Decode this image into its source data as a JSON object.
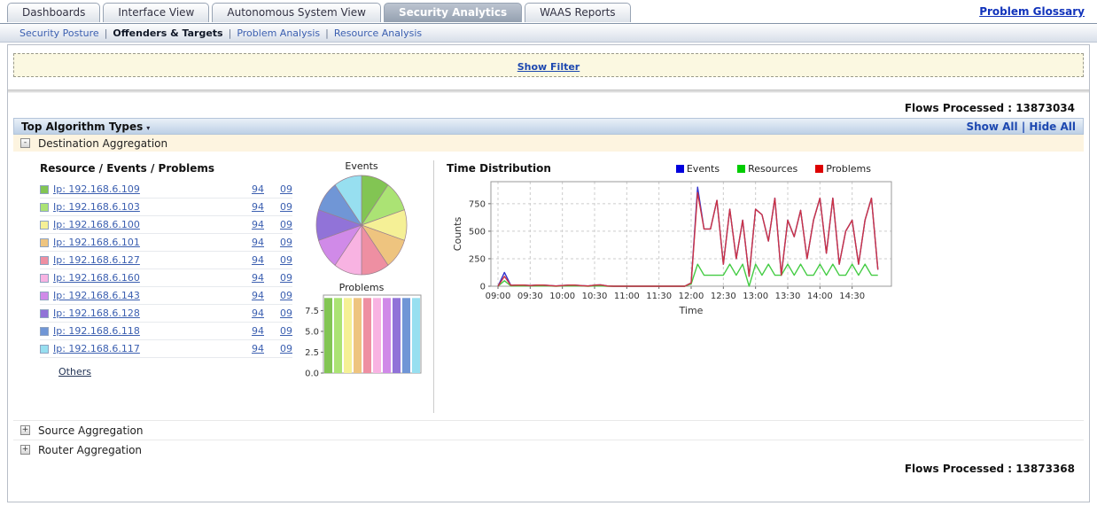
{
  "header": {
    "tabs": [
      {
        "label": "Dashboards"
      },
      {
        "label": "Interface View"
      },
      {
        "label": "Autonomous System View"
      },
      {
        "label": "Security Analytics"
      },
      {
        "label": "WAAS Reports"
      }
    ],
    "active_tab": "Security Analytics",
    "problem_glossary": "Problem Glossary",
    "subnav": [
      "Security Posture",
      "Offenders & Targets",
      "Problem Analysis",
      "Resource Analysis"
    ],
    "subnav_active": "Offenders & Targets",
    "separator": "|"
  },
  "filter": {
    "show_filter_label": "Show Filter"
  },
  "flows": {
    "top": "Flows Processed : 13873034",
    "bottom": "Flows Processed : 13873368"
  },
  "panel": {
    "title": "Top Algorithm Types",
    "show_all": "Show All",
    "hide_all": "Hide All",
    "links_separator": "|",
    "sections": [
      {
        "label": "Destination Aggregation",
        "state": "expanded"
      },
      {
        "label": "Source Aggregation",
        "state": "collapsed"
      },
      {
        "label": "Router Aggregation",
        "state": "collapsed"
      }
    ]
  },
  "icons": {
    "expanded": "-",
    "collapsed": "+",
    "panel_arrow": "▾"
  },
  "destination": {
    "list_title": "Resource / Events / Problems",
    "others_label": "Others",
    "resources": [
      {
        "label": "Ip: 192.168.6.109",
        "color": "#82c553",
        "events": "94",
        "problems": "09"
      },
      {
        "label": "Ip: 192.168.6.103",
        "color": "#abe374",
        "events": "94",
        "problems": "09"
      },
      {
        "label": "Ip: 192.168.6.100",
        "color": "#f5f096",
        "events": "94",
        "problems": "09"
      },
      {
        "label": "Ip: 192.168.6.101",
        "color": "#eec47f",
        "events": "94",
        "problems": "09"
      },
      {
        "label": "Ip: 192.168.6.127",
        "color": "#ee8fa2",
        "events": "94",
        "problems": "09"
      },
      {
        "label": "Ip: 192.168.6.160",
        "color": "#f8b3e2",
        "events": "94",
        "problems": "09"
      },
      {
        "label": "Ip: 192.168.6.143",
        "color": "#d08ae8",
        "events": "94",
        "problems": "09"
      },
      {
        "label": "Ip: 192.168.6.128",
        "color": "#9173d8",
        "events": "94",
        "problems": "09"
      },
      {
        "label": "Ip: 192.168.6.118",
        "color": "#7096d6",
        "events": "94",
        "problems": "09"
      },
      {
        "label": "Ip: 192.168.6.117",
        "color": "#97dff0",
        "events": "94",
        "problems": "09"
      }
    ]
  },
  "time_distribution": {
    "title": "Time Distribution",
    "legend": [
      {
        "label": "Events",
        "color": "#0000dd"
      },
      {
        "label": "Resources",
        "color": "#00cc00"
      },
      {
        "label": "Problems",
        "color": "#dd0000"
      }
    ]
  },
  "chart_data": [
    {
      "id": "events-pie",
      "type": "pie",
      "title": "Events",
      "labels": [
        "Ip: 192.168.6.109",
        "Ip: 192.168.6.103",
        "Ip: 192.168.6.100",
        "Ip: 192.168.6.101",
        "Ip: 192.168.6.127",
        "Ip: 192.168.6.160",
        "Ip: 192.168.6.143",
        "Ip: 192.168.6.128",
        "Ip: 192.168.6.118",
        "Ip: 192.168.6.117"
      ],
      "values": [
        10,
        10,
        10,
        10,
        10,
        10,
        10,
        10,
        10,
        10
      ],
      "colors": [
        "#82c553",
        "#abe374",
        "#f5f096",
        "#eec47f",
        "#ee8fa2",
        "#f8b3e2",
        "#d08ae8",
        "#9173d8",
        "#7096d6",
        "#97dff0"
      ]
    },
    {
      "id": "problems-bars",
      "type": "bar",
      "title": "Problems",
      "categories": [
        "Ip: 192.168.6.109",
        "Ip: 192.168.6.103",
        "Ip: 192.168.6.100",
        "Ip: 192.168.6.101",
        "Ip: 192.168.6.127",
        "Ip: 192.168.6.160",
        "Ip: 192.168.6.143",
        "Ip: 192.168.6.128",
        "Ip: 192.168.6.118",
        "Ip: 192.168.6.117"
      ],
      "values": [
        9,
        9,
        9,
        9,
        9,
        9,
        9,
        9,
        9,
        9
      ],
      "colors": [
        "#82c553",
        "#abe374",
        "#f5f096",
        "#eec47f",
        "#ee8fa2",
        "#f8b3e2",
        "#d08ae8",
        "#9173d8",
        "#7096d6",
        "#97dff0"
      ],
      "yticks": [
        0.0,
        2.5,
        5.0,
        7.5
      ],
      "ylim": [
        0,
        9.35
      ]
    },
    {
      "id": "time-distribution",
      "type": "line",
      "title": "Time Distribution",
      "xlabel": "Time",
      "ylabel": "Counts",
      "ylim": [
        0,
        950
      ],
      "yticks": [
        0,
        250,
        500,
        750
      ],
      "x_start_minutes": 540,
      "x_step_minutes": 6,
      "x_span_minutes": 360,
      "xtick_labels": [
        "09:00",
        "09:30",
        "10:00",
        "10:30",
        "11:00",
        "11:30",
        "12:00",
        "12:30",
        "13:00",
        "13:30",
        "14:00",
        "14:30"
      ],
      "grid": "dashed",
      "legend_position": "top-right",
      "series": [
        {
          "name": "Events",
          "color": "#3333cc",
          "values": [
            0,
            125,
            8,
            10,
            10,
            6,
            10,
            10,
            6,
            2,
            6,
            10,
            10,
            5,
            2,
            10,
            12,
            2,
            0,
            0,
            0,
            0,
            0,
            0,
            0,
            0,
            0,
            0,
            0,
            0,
            30,
            900,
            520,
            520,
            780,
            200,
            700,
            250,
            600,
            90,
            700,
            650,
            410,
            800,
            100,
            600,
            450,
            690,
            250,
            600,
            800,
            300,
            800,
            200,
            500,
            600,
            200,
            600,
            800,
            150
          ]
        },
        {
          "name": "Resources",
          "color": "#44cc44",
          "values": [
            0,
            50,
            3,
            3,
            3,
            3,
            3,
            3,
            3,
            0,
            3,
            3,
            3,
            3,
            0,
            3,
            3,
            0,
            0,
            0,
            0,
            0,
            0,
            0,
            0,
            0,
            0,
            0,
            0,
            0,
            20,
            200,
            100,
            100,
            100,
            100,
            200,
            100,
            200,
            0,
            200,
            100,
            200,
            100,
            100,
            200,
            100,
            200,
            100,
            100,
            200,
            100,
            200,
            100,
            100,
            200,
            100,
            200,
            100,
            100
          ]
        },
        {
          "name": "Problems",
          "color": "#cc3344",
          "values": [
            0,
            90,
            8,
            10,
            10,
            6,
            10,
            10,
            6,
            2,
            6,
            10,
            10,
            5,
            2,
            10,
            12,
            2,
            0,
            0,
            0,
            0,
            0,
            0,
            0,
            0,
            0,
            0,
            0,
            0,
            30,
            850,
            520,
            520,
            780,
            200,
            700,
            250,
            600,
            90,
            700,
            650,
            410,
            800,
            100,
            600,
            450,
            690,
            250,
            600,
            800,
            300,
            800,
            200,
            500,
            600,
            200,
            600,
            800,
            150
          ]
        }
      ]
    }
  ]
}
